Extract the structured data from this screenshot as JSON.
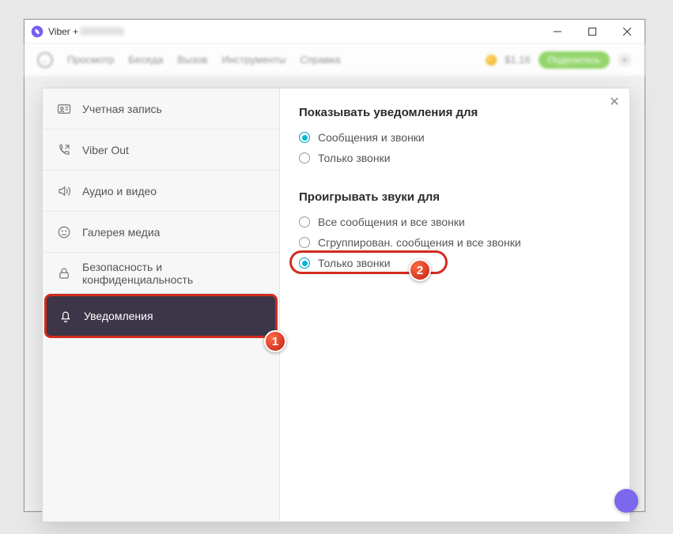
{
  "window": {
    "title_prefix": "Viber + "
  },
  "toolbar": {
    "items": [
      "Просмотр",
      "Беседа",
      "Вызов",
      "Инструменты",
      "Справка"
    ],
    "balance": "$1.16",
    "promote": "Поделитесь"
  },
  "sidebar": {
    "items": [
      {
        "id": "account",
        "label": "Учетная запись"
      },
      {
        "id": "viberout",
        "label": "Viber Out"
      },
      {
        "id": "audiovideo",
        "label": "Аудио и видео"
      },
      {
        "id": "gallery",
        "label": "Галерея медиа"
      },
      {
        "id": "security",
        "label": "Безопасность и конфиденциальность"
      },
      {
        "id": "notifications",
        "label": "Уведомления"
      }
    ]
  },
  "content": {
    "section1": {
      "title": "Показывать уведомления для",
      "options": [
        {
          "label": "Сообщения и звонки",
          "checked": true
        },
        {
          "label": "Только звонки",
          "checked": false
        }
      ]
    },
    "section2": {
      "title": "Проигрывать звуки для",
      "options": [
        {
          "label": "Все сообщения и все звонки",
          "checked": false
        },
        {
          "label": "Сгруппирован. сообщения и все звонки",
          "checked": false
        },
        {
          "label": "Только звонки",
          "checked": true
        }
      ]
    }
  },
  "steps": {
    "one": "1",
    "two": "2"
  }
}
